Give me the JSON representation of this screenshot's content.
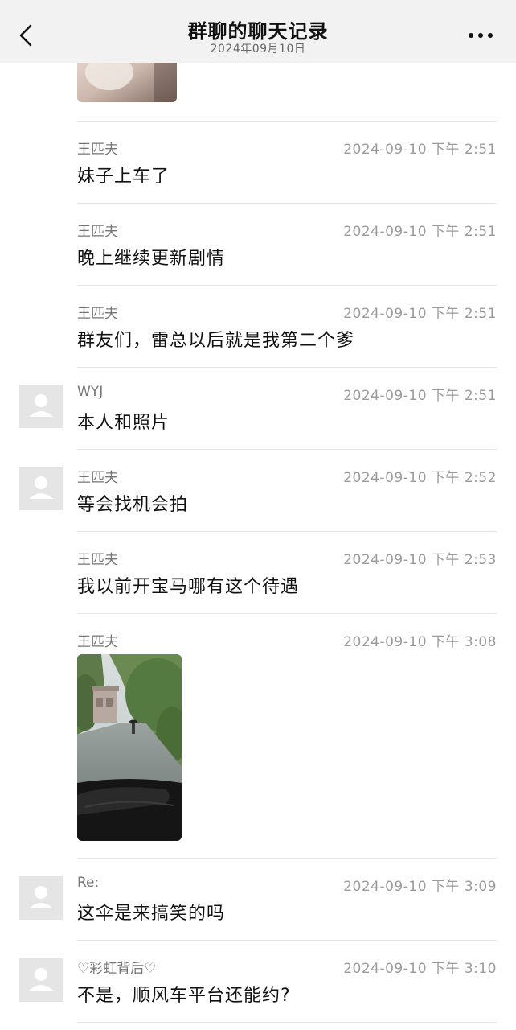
{
  "header": {
    "title": "群聊的聊天记录",
    "date": "2024年09月10日",
    "back_icon": "chevron-left-icon",
    "more_icon": "more-horizontal-icon"
  },
  "messages": [
    {
      "sender": "王匹夫",
      "time": "2024-09-10 下午 2:51",
      "text": "妹子上车了",
      "avatar": false
    },
    {
      "sender": "王匹夫",
      "time": "2024-09-10 下午 2:51",
      "text": "晚上继续更新剧情",
      "avatar": false
    },
    {
      "sender": "王匹夫",
      "time": "2024-09-10 下午 2:51",
      "text": "群友们，雷总以后就是我第二个爹",
      "avatar": false
    },
    {
      "sender": "WYJ",
      "time": "2024-09-10 下午 2:51",
      "text": "本人和照片",
      "avatar": true
    },
    {
      "sender": "王匹夫",
      "time": "2024-09-10 下午 2:52",
      "text": "等会找机会拍",
      "avatar": true
    },
    {
      "sender": "王匹夫",
      "time": "2024-09-10 下午 2:53",
      "text": "我以前开宝马哪有这个待遇",
      "avatar": false
    },
    {
      "sender": "王匹夫",
      "time": "2024-09-10 下午 3:08",
      "image": "photo-rainy-street",
      "avatar": false
    },
    {
      "sender": "Re:",
      "time": "2024-09-10 下午 3:09",
      "text": "这伞是来搞笑的吗",
      "avatar": true
    },
    {
      "sender": "♡彩虹背后♡",
      "time": "2024-09-10 下午 3:10",
      "text": "不是，顺风车平台还能约?",
      "avatar": true
    }
  ],
  "colors": {
    "navbar_bg": "#f2f2f2",
    "divider": "#e6e6e6",
    "sender": "#767676",
    "timestamp": "#9a9a9a",
    "avatar_bg": "#e5e5e5"
  }
}
